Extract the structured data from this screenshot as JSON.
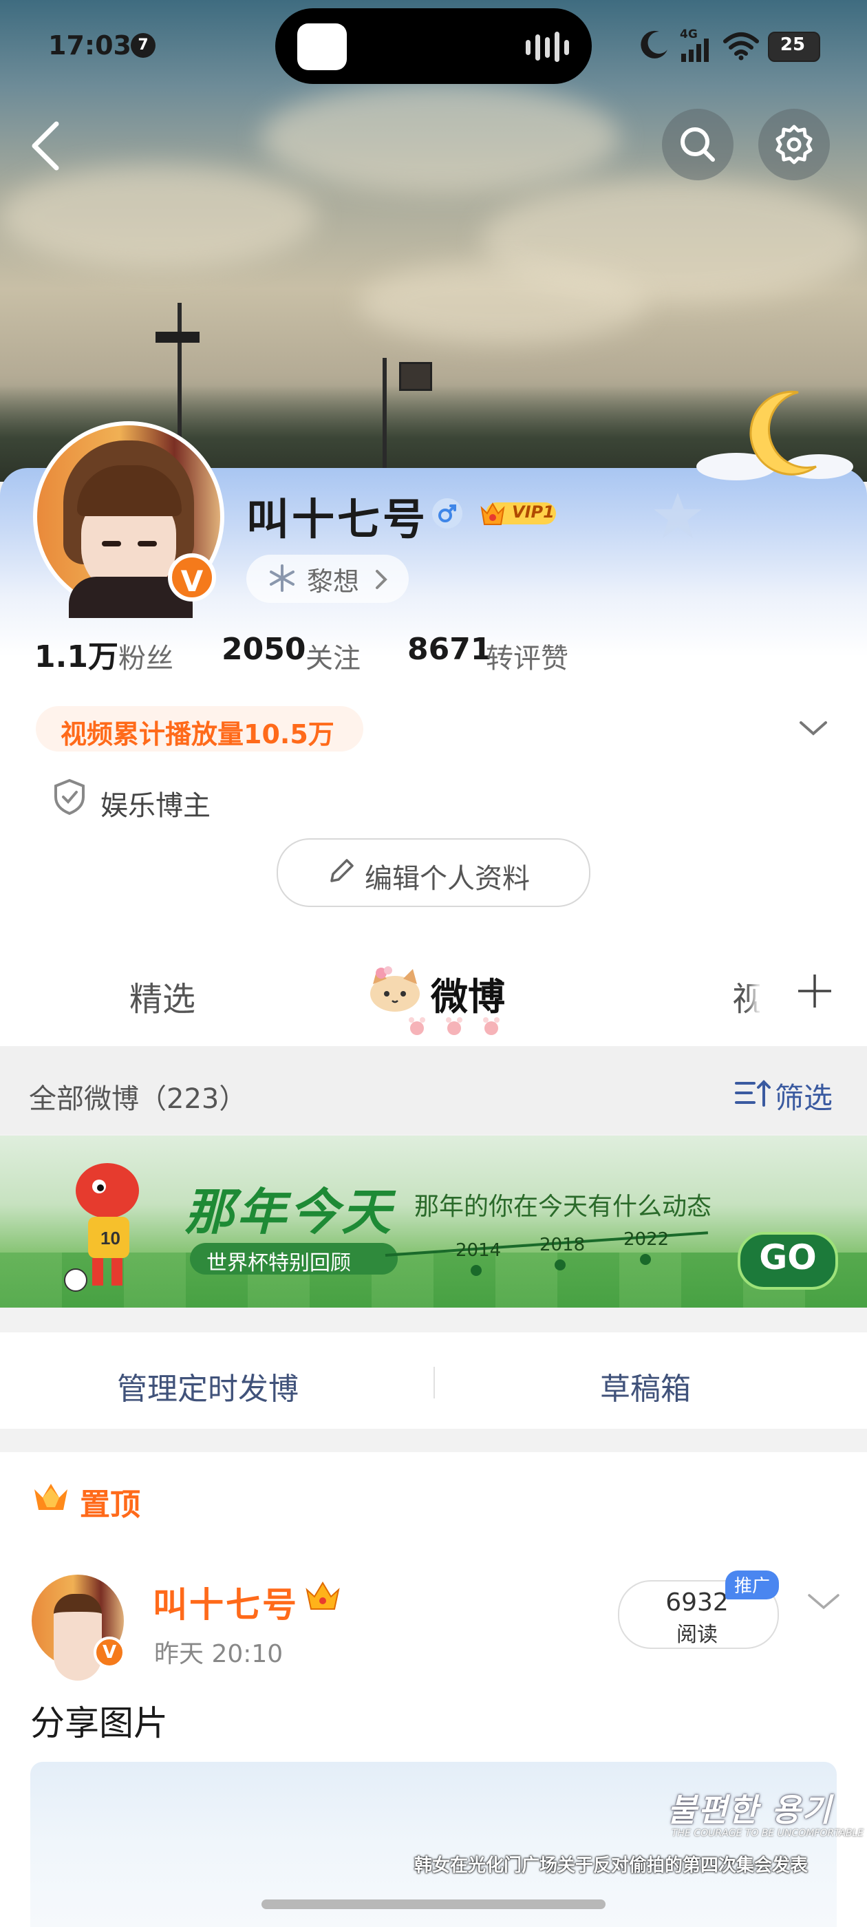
{
  "status_bar": {
    "time": "17:03",
    "notification_count": "7",
    "network": "4G",
    "battery": "25"
  },
  "header": {
    "back_icon": "chevron-left-icon",
    "search_icon": "search-icon",
    "settings_icon": "gear-icon"
  },
  "profile": {
    "name": "叫十七号",
    "gender_icon": "male-icon",
    "vip_label": "VIP1",
    "tag": "黎想",
    "verified_mark": "V",
    "stats": [
      {
        "value": "1.1万",
        "label": "粉丝"
      },
      {
        "value": "2050",
        "label": "关注"
      },
      {
        "value": "8671",
        "label": "转评赞"
      }
    ],
    "video_plays": "视频累计播放量10.5万",
    "category": "娱乐博主",
    "edit_button": "编辑个人资料"
  },
  "tabs": {
    "items": [
      "精选",
      "微博",
      "视频"
    ],
    "active": "微博"
  },
  "feed_header": {
    "title": "全部微博（223）",
    "filter": "筛选"
  },
  "banner": {
    "title": "那年今天",
    "subtitle": "那年的你在今天有什么动态",
    "tag": "世界杯特别回顾",
    "years": [
      "2014",
      "2018",
      "2022"
    ],
    "go": "GO"
  },
  "actions": {
    "scheduled": "管理定时发博",
    "drafts": "草稿箱"
  },
  "post": {
    "pinned_label": "置顶",
    "author": "叫十七号",
    "time": "昨天 20:10",
    "reads": "6932",
    "reads_label": "阅读",
    "promo": "推广",
    "text": "分享图片",
    "image_logo": "불편한 용기",
    "image_logo_sub": "THE COURAGE TO BE UNCOMFORTABLE",
    "image_caption": "韩女在光化门广场关于反对偷拍的第四次集会发表"
  },
  "colors": {
    "accent_orange": "#ff6a1a",
    "link_blue": "#3a5aa0",
    "verified_orange": "#f57a1b"
  }
}
